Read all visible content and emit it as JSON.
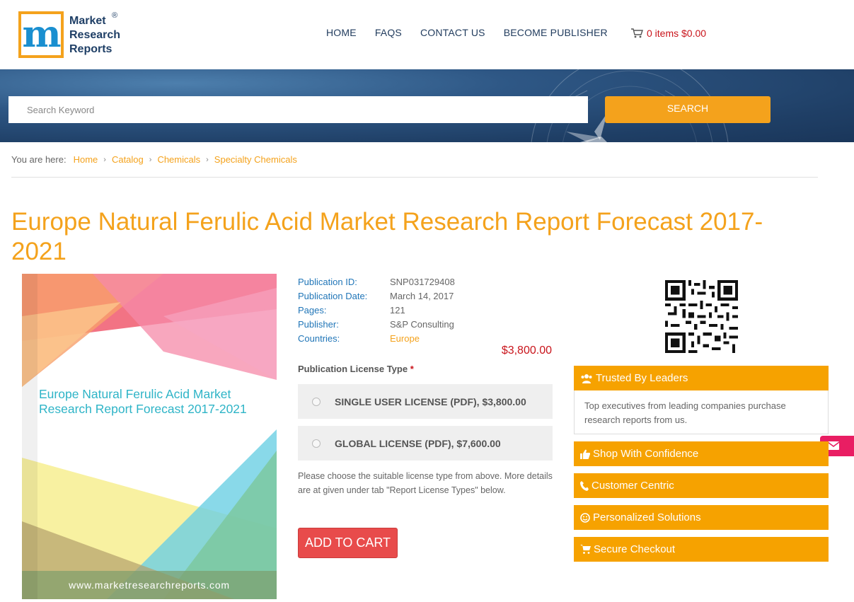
{
  "brand": {
    "logo_letter": "m",
    "name_line1": "Market",
    "name_line2": "Research",
    "name_line3": "Reports",
    "registered": "®"
  },
  "nav": {
    "items": [
      "HOME",
      "FAQS",
      "CONTACT US",
      "BECOME PUBLISHER"
    ],
    "cart_label": "0 items $0.00"
  },
  "search": {
    "placeholder": "Search Keyword",
    "button_label": "SEARCH"
  },
  "breadcrumb": {
    "lead": "You are here:",
    "items": [
      "Home",
      "Catalog",
      "Chemicals",
      "Specialty Chemicals"
    ]
  },
  "report": {
    "title": "Europe Natural Ferulic Acid Market Research Report Forecast 2017-2021",
    "cover_title": "Europe Natural Ferulic Acid Market Research Report Forecast 2017-2021",
    "cover_url": "www.marketresearchreports.com",
    "meta": [
      {
        "label": "Publication ID:",
        "value": "SNP031729408"
      },
      {
        "label": "Publication Date:",
        "value": "March 14, 2017"
      },
      {
        "label": "Pages:",
        "value": "121"
      },
      {
        "label": "Publisher:",
        "value": "S&P Consulting"
      },
      {
        "label": "Countries:",
        "value": "Europe"
      }
    ],
    "price": "$3,800.00"
  },
  "license": {
    "label": "Publication License Type",
    "required_mark": "*",
    "options": [
      "SINGLE USER LICENSE (PDF), $3,800.00",
      "GLOBAL LICENSE (PDF), $7,600.00"
    ],
    "note": "Please choose the suitable license type from above. More details are at given under tab \"Report License Types\" below.",
    "add_to_cart": "ADD TO CART"
  },
  "sidebar": {
    "trusted_title": "Trusted By Leaders",
    "trusted_body": "Top executives from leading companies purchase research reports from us.",
    "panels": [
      "Shop With Confidence",
      "Customer Centric",
      "Personalized Solutions",
      "Secure Checkout"
    ]
  },
  "colors": {
    "accent": "#f4a21c",
    "nav_text": "#1f3a5c",
    "price_red": "#c9141b",
    "link_blue": "#2176b8",
    "add_to_cart": "#e84b4b",
    "mail_tab": "#e91e63"
  }
}
